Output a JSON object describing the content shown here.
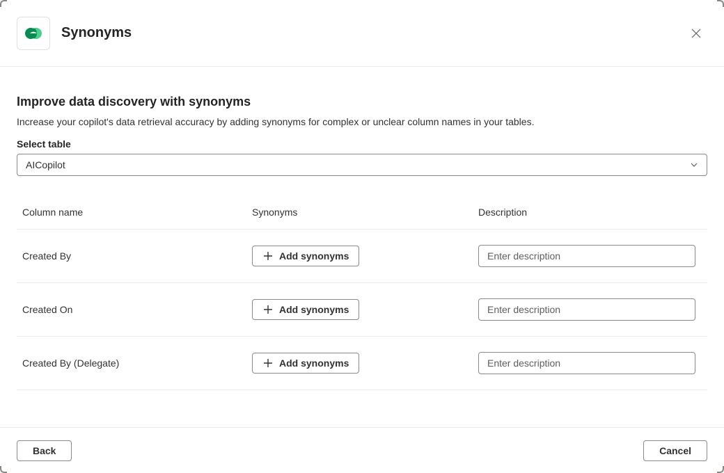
{
  "header": {
    "title": "Synonyms"
  },
  "main": {
    "title": "Improve data discovery with synonyms",
    "description": "Increase your copilot's data retrieval accuracy by adding synonyms for complex or unclear column names in your tables.",
    "select_label": "Select table",
    "select_value": "AICopilot"
  },
  "grid": {
    "headers": {
      "col_name": "Column name",
      "synonyms": "Synonyms",
      "description": "Description"
    },
    "add_synonyms_label": "Add synonyms",
    "desc_placeholder": "Enter description",
    "rows": [
      {
        "name": "Created By"
      },
      {
        "name": "Created On"
      },
      {
        "name": "Created By (Delegate)"
      }
    ]
  },
  "footer": {
    "back": "Back",
    "cancel": "Cancel"
  }
}
